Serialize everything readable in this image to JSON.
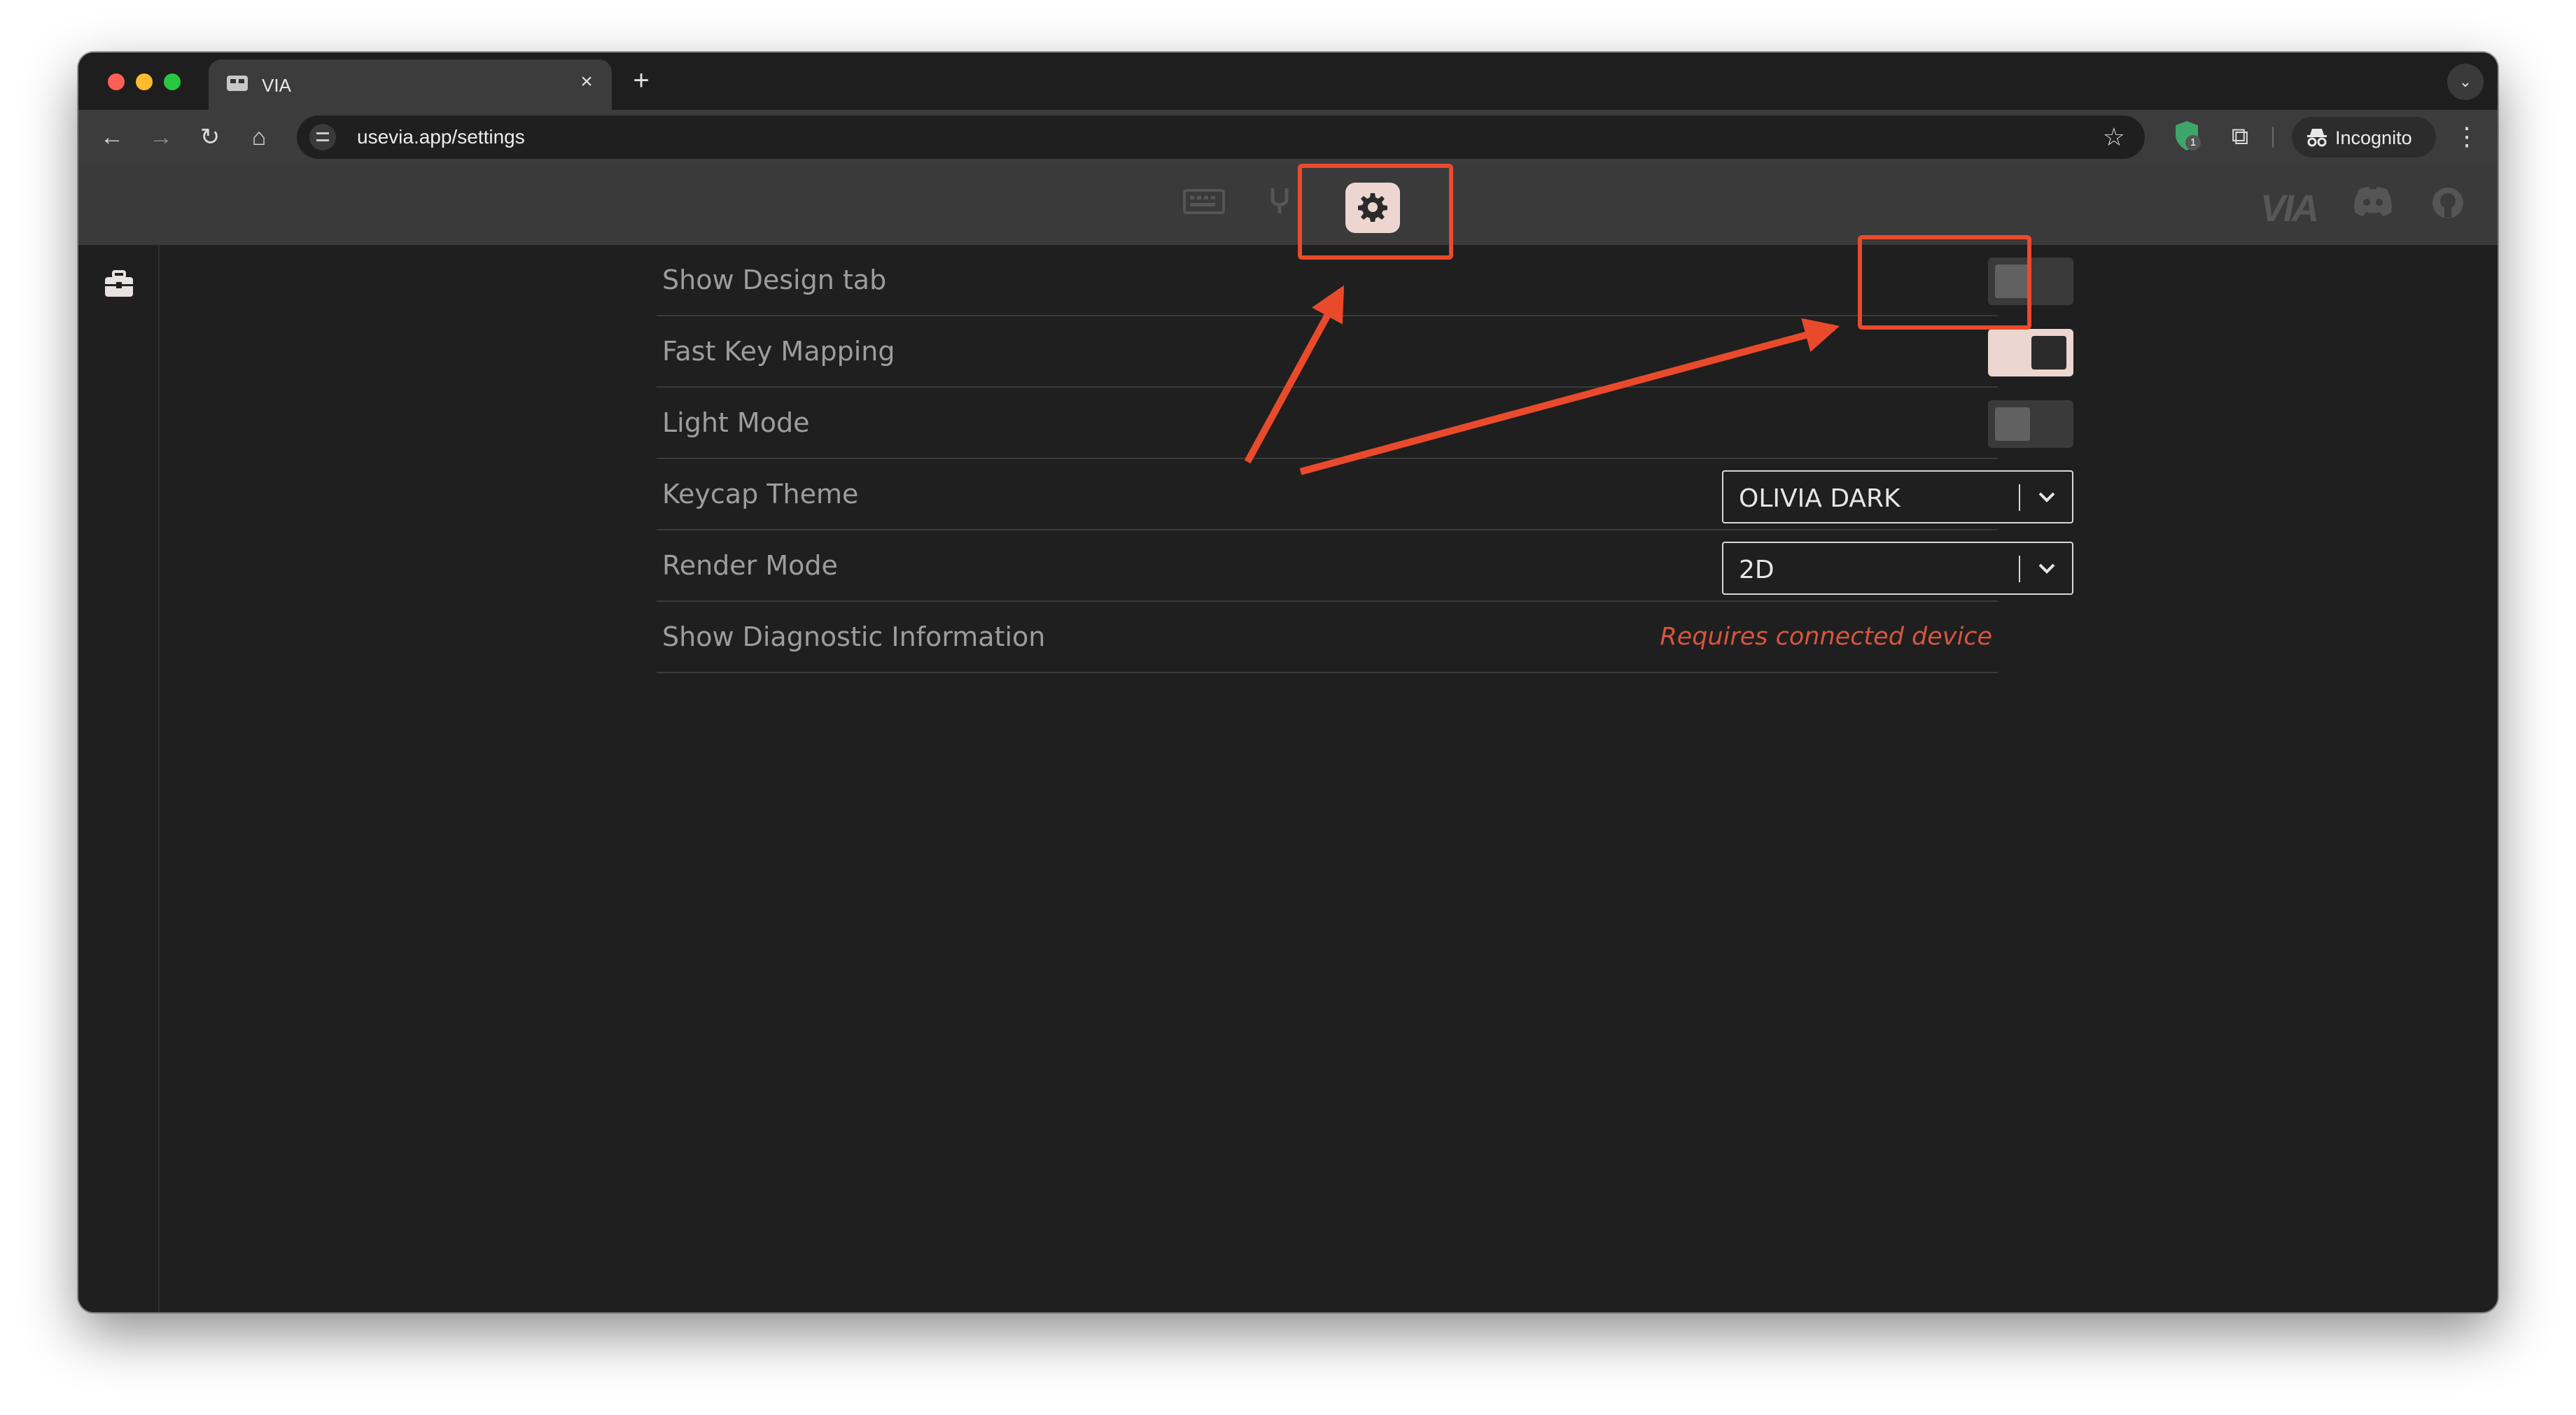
{
  "browser": {
    "tab": {
      "title": "VIA",
      "close_glyph": "×"
    },
    "new_tab_glyph": "+",
    "tab_search_glyph": "⌄",
    "nav": {
      "back": "←",
      "forward": "→",
      "reload": "↻",
      "home": "⌂"
    },
    "address_bar": {
      "url": "usevia.app/settings",
      "star_glyph": "☆"
    },
    "extensions": {
      "badge_count": "1",
      "puzzle_glyph": "⧉"
    },
    "incognito_label": "Incognito",
    "menu_glyph": "⋮"
  },
  "app": {
    "header": {
      "nav_icons": [
        "keyboard-icon",
        "stethoscope-icon",
        "gear-icon"
      ],
      "active_tab": "settings",
      "brand_logo": "VIA",
      "right_icons": [
        "discord-icon",
        "github-icon"
      ]
    },
    "sidebar": {
      "icons": [
        "toolbox-icon"
      ]
    },
    "settings": {
      "show_design_tab": {
        "label": "Show Design tab",
        "enabled": false
      },
      "fast_key_mapping": {
        "label": "Fast Key Mapping",
        "enabled": true
      },
      "light_mode": {
        "label": "Light Mode",
        "enabled": false
      },
      "keycap_theme": {
        "label": "Keycap Theme",
        "value": "OLIVIA DARK"
      },
      "render_mode": {
        "label": "Render Mode",
        "value": "2D"
      },
      "diagnostics": {
        "label": "Show Diagnostic Information",
        "status": "Requires connected device"
      }
    },
    "colors": {
      "accent": "#ecd6cf",
      "header_bg": "#3a3a3a",
      "body_bg": "#1f1f1f",
      "warning_text": "#d6563f",
      "annotation": "#ea4a2c"
    }
  }
}
